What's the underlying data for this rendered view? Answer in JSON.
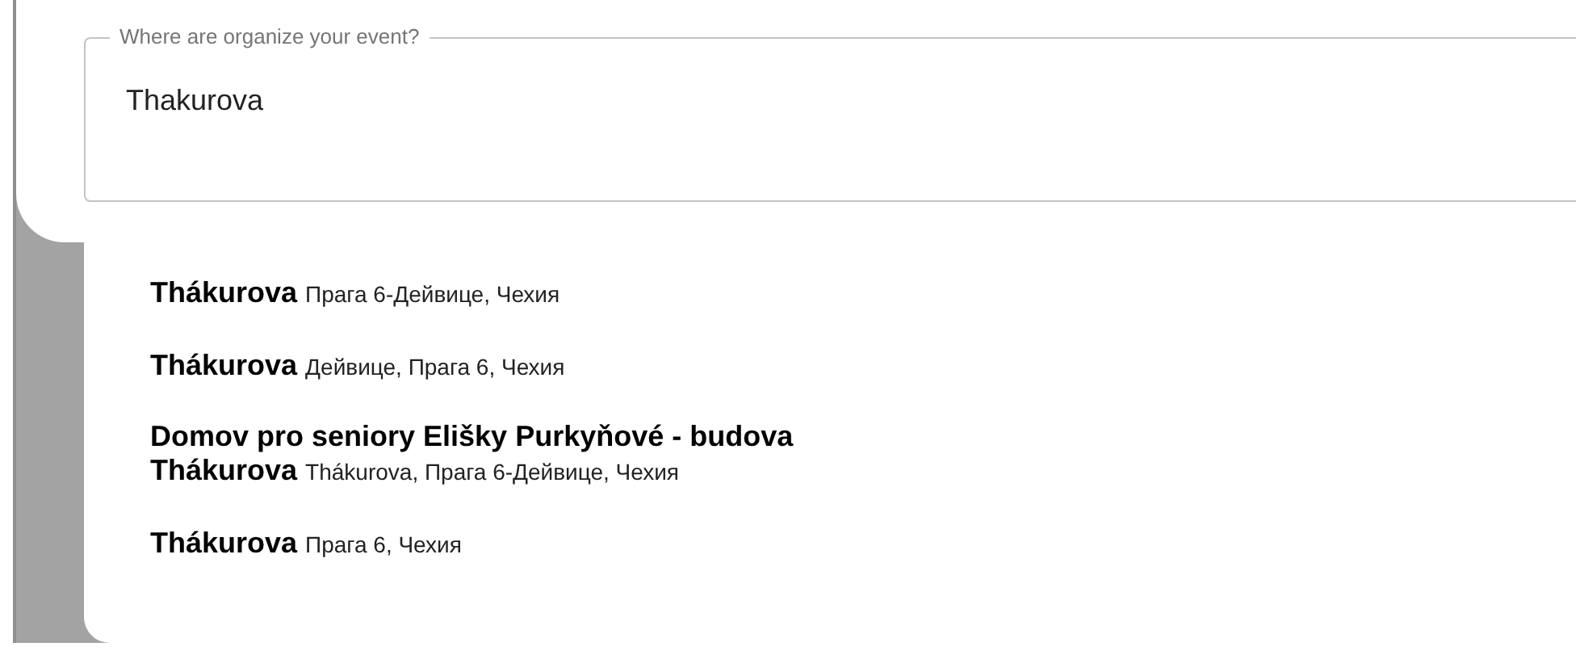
{
  "location_field": {
    "label": "Where are organize your event?",
    "value": "Thakurova"
  },
  "suggestions": [
    {
      "main": "Thákurova",
      "secondary": "Прага 6-Дейвице, Чехия"
    },
    {
      "main": "Thákurova",
      "secondary": "Дейвице, Прага 6, Чехия"
    },
    {
      "title": "Domov pro seniory Elišky Purkyňové - budova",
      "main": "Thákurova",
      "secondary": "Thákurova, Прага 6-Дейвице, Чехия"
    },
    {
      "main": "Thákurova",
      "secondary": "Прага 6, Чехия"
    }
  ]
}
